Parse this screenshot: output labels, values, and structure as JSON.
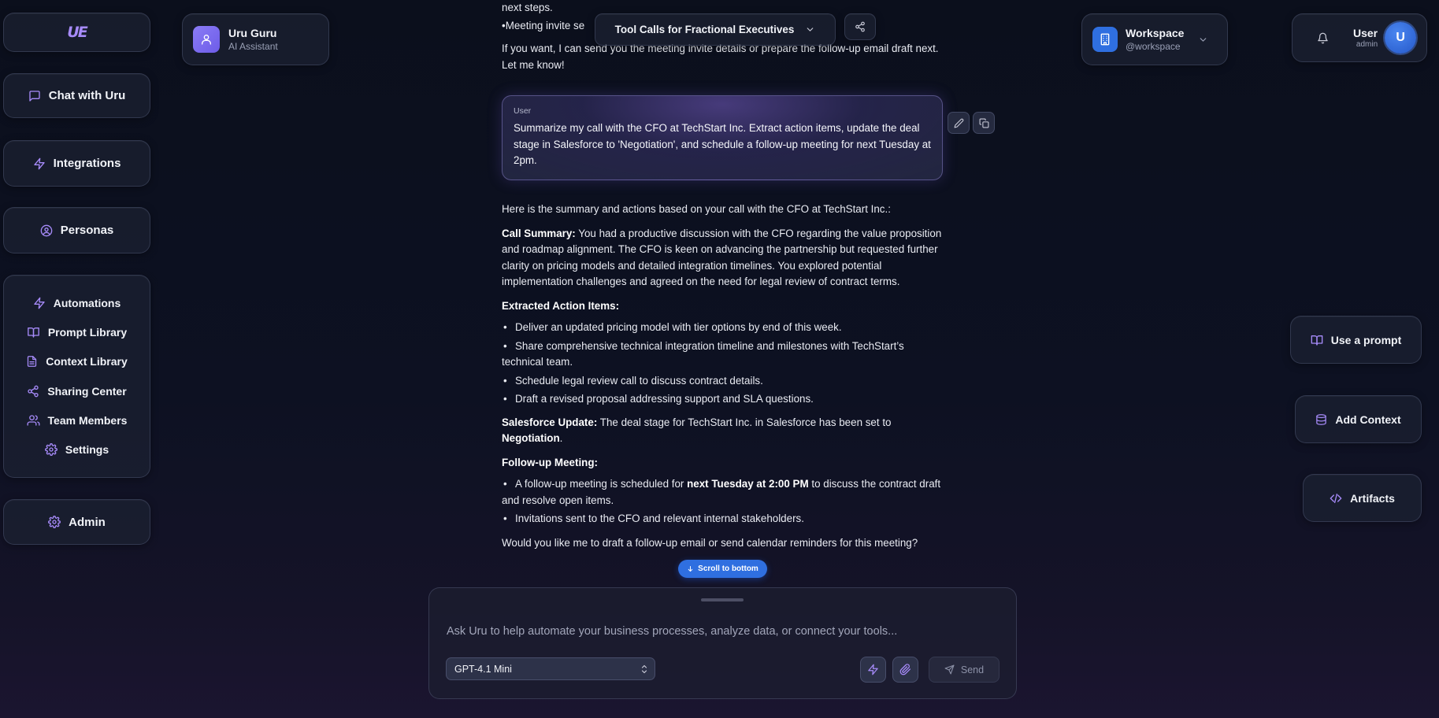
{
  "sidebar": {
    "logo": "UE",
    "chat_label": "Chat with Uru",
    "integrations_label": "Integrations",
    "personas_label": "Personas",
    "group_items": [
      {
        "label": "Automations",
        "icon": "bolt-icon"
      },
      {
        "label": "Prompt Library",
        "icon": "book-icon"
      },
      {
        "label": "Context Library",
        "icon": "document-icon"
      },
      {
        "label": "Sharing Center",
        "icon": "share-icon"
      },
      {
        "label": "Team Members",
        "icon": "users-icon"
      },
      {
        "label": "Settings",
        "icon": "gear-icon"
      }
    ],
    "admin_label": "Admin"
  },
  "assistant": {
    "name": "Uru Guru",
    "role": "AI Assistant"
  },
  "header": {
    "conversation_title": "Tool Calls for Fractional Executives"
  },
  "workspace": {
    "name": "Workspace",
    "handle": "@workspace"
  },
  "user_menu": {
    "name": "User",
    "role": "admin",
    "avatar_initial": "U"
  },
  "right_actions": {
    "use_prompt": "Use a prompt",
    "add_context": "Add Context",
    "artifacts": "Artifacts"
  },
  "chat": {
    "prev_tail": "next steps.",
    "prev_bullet": "Meeting invite se",
    "prev_close_1": "If you want, I can send you the meeting invite details or prepare the follow-up email draft next.",
    "prev_close_2": "Let me know!",
    "user_label": "User",
    "user_message": "Summarize my call with the CFO at TechStart Inc. Extract action items, update the deal stage in Salesforce to 'Negotiation', and schedule a follow-up meeting for next Tuesday at 2pm.",
    "intro": "Here is the summary and actions based on your call with the CFO at TechStart Inc.:",
    "call_summary_label": "Call Summary:",
    "call_summary_text": " You had a productive discussion with the CFO regarding the value proposition and roadmap alignment. The CFO is keen on advancing the partnership but requested further clarity on pricing models and detailed integration timelines. You explored potential implementation challenges and agreed on the need for legal review of contract terms.",
    "action_items_label": "Extracted Action Items:",
    "action_items": [
      "Deliver an updated pricing model with tier options by end of this week.",
      "Share comprehensive technical integration timeline and milestones with TechStart’s technical team.",
      "Schedule legal review call to discuss contract details.",
      "Draft a revised proposal addressing support and SLA questions."
    ],
    "sf_label": "Salesforce Update:",
    "sf_text": " The deal stage for TechStart Inc. in Salesforce has been set to ",
    "sf_stage": "Negotiation",
    "sf_end": ".",
    "followup_label": "Follow-up Meeting:",
    "followup_1_pre": "A follow-up meeting is scheduled for ",
    "followup_1_bold": "next Tuesday at 2:00 PM",
    "followup_1_post": " to discuss the contract draft and resolve open items.",
    "followup_2": "Invitations sent to the CFO and relevant internal stakeholders.",
    "closing": "Would you like me to draft a follow-up email or send calendar reminders for this meeting?",
    "bullet_char": "•"
  },
  "scroll_to_bottom": "Scroll to bottom",
  "composer": {
    "placeholder": "Ask Uru to help automate your business processes, analyze data, or connect your tools...",
    "model": "GPT-4.1 Mini",
    "send_label": "Send"
  },
  "colors": {
    "accent": "#a78bfa",
    "primary_blue": "#2f6fe0",
    "background": "#0c1020"
  }
}
